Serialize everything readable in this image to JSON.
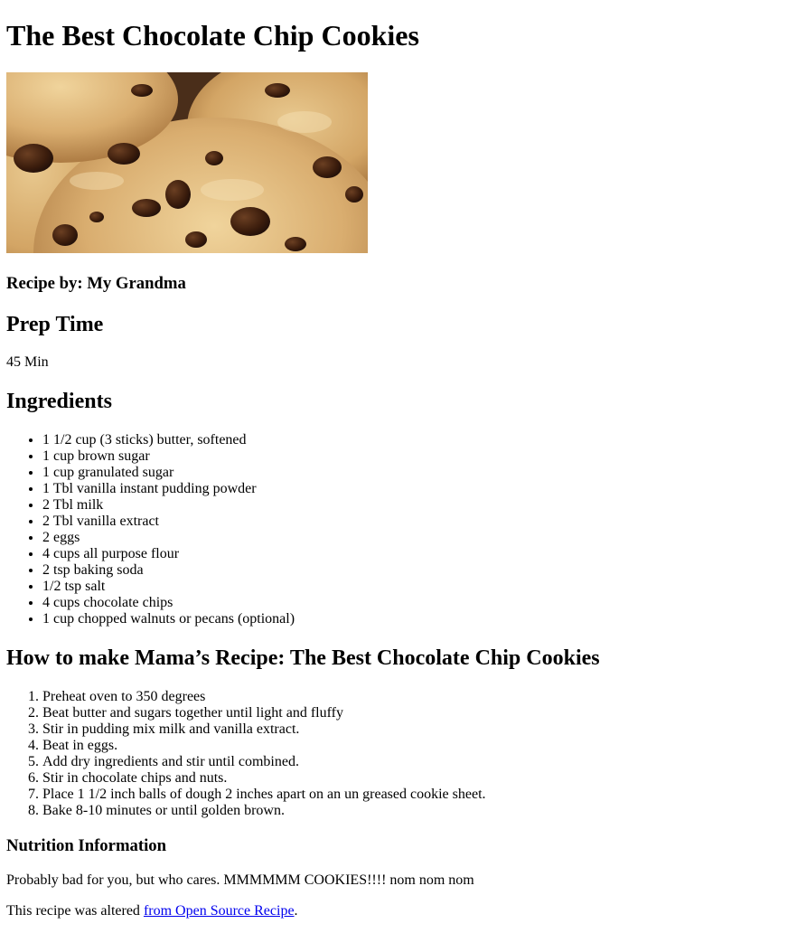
{
  "page": {
    "title": "The Best Chocolate Chip Cookies",
    "image_alt": "chocolate-chip-cookies-photo",
    "author_label": "Recipe by: My Grandma",
    "prep": {
      "heading": "Prep Time",
      "value": "45 Min"
    },
    "ingredients": {
      "heading": "Ingredients",
      "items": [
        "1 1/2 cup (3 sticks) butter, softened",
        "1 cup brown sugar",
        "1 cup granulated sugar",
        "1 Tbl vanilla instant pudding powder",
        "2 Tbl milk",
        "2 Tbl vanilla extract",
        "2 eggs",
        "4 cups all purpose flour",
        "2 tsp baking soda",
        "1/2 tsp salt",
        "4 cups chocolate chips",
        "1 cup chopped walnuts or pecans (optional)"
      ]
    },
    "instructions": {
      "heading": "How to make Mama’s Recipe: The Best Chocolate Chip Cookies",
      "steps": [
        "Preheat oven to 350 degrees",
        "Beat butter and sugars together until light and fluffy",
        "Stir in pudding mix milk and vanilla extract.",
        "Beat in eggs.",
        "Add dry ingredients and stir until combined.",
        "Stir in chocolate chips and nuts.",
        "Place 1 1/2 inch balls of dough 2 inches apart on an un greased cookie sheet.",
        "Bake 8-10 minutes or until golden brown."
      ]
    },
    "nutrition": {
      "heading": "Nutrition Information",
      "text": "Probably bad for you, but who cares. MMMMMM COOKIES!!!! nom nom nom"
    },
    "source": {
      "prefix": "This recipe was altered ",
      "link_text": "from Open Source Recipe",
      "suffix": "."
    }
  },
  "colors": {
    "text": "#000000",
    "link": "#0000ee",
    "background": "#ffffff"
  }
}
